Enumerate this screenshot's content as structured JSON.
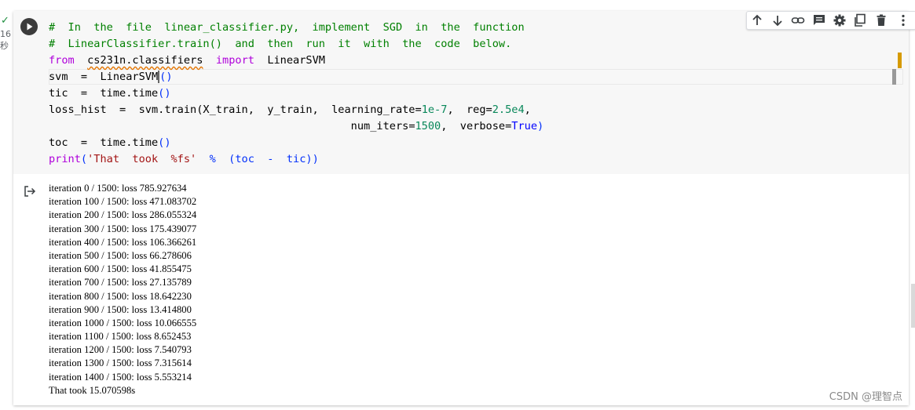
{
  "cell": {
    "status": "✓",
    "exec_time": "16\n秒",
    "code_lines": [
      "# In the file linear_classifier.py, implement SGD in the function",
      "# LinearClassifier.train() and then run it with the code below.",
      "from cs231n.classifiers import LinearSVM",
      "svm = LinearSVM()",
      "tic = time.time()",
      "loss_hist = svm.train(X_train, y_train, learning_rate=1e-7, reg=2.5e4,",
      "                      num_iters=1500, verbose=True)",
      "toc = time.time()",
      "print('That took %fs' % (toc - tic))"
    ],
    "code_tokens": {
      "comment1": "#  In  the  file  linear_classifier.py,  implement  SGD  in  the  function",
      "comment2": "#  LinearClassifier.train()  and  then  run  it  with  the  code  below.",
      "from": "from",
      "module": "cs231n.classifiers",
      "import": "import",
      "class_name": "LinearSVM",
      "svm_assign": "svm  =  LinearSVM",
      "svm_parens": "()",
      "tic_assign": "tic  =  time.time",
      "tic_parens": "()",
      "loss_prefix": "loss_hist  =  svm.train(X_train,  y_train,  learning_rate=",
      "lr_value": "1e-7",
      "reg_prefix": ",  reg=",
      "reg_value": "2.5e4",
      "reg_suffix": ",",
      "indent": "                                               ",
      "iters_prefix": "num_iters=",
      "iters_value": "1500",
      "verbose_prefix": ",  verbose=",
      "verbose_value": "True",
      "call_close": ")",
      "toc_assign": "toc  =  time.time",
      "toc_parens": "()",
      "print_kw": "print",
      "print_open": "(",
      "print_str": "'That  took  %fs'",
      "print_rest": "  %  (toc  -  tic))"
    }
  },
  "toolbar": {
    "icons": [
      "arrow-up-icon",
      "arrow-down-icon",
      "link-icon",
      "comment-icon",
      "gear-icon",
      "mirror-cell-icon",
      "delete-icon",
      "more-vert-icon"
    ]
  },
  "output": {
    "lines": [
      "iteration 0 / 1500: loss 785.927634",
      "iteration 100 / 1500: loss 471.083702",
      "iteration 200 / 1500: loss 286.055324",
      "iteration 300 / 1500: loss 175.439077",
      "iteration 400 / 1500: loss 106.366261",
      "iteration 500 / 1500: loss 66.278606",
      "iteration 600 / 1500: loss 41.855475",
      "iteration 700 / 1500: loss 27.135789",
      "iteration 800 / 1500: loss 18.642230",
      "iteration 900 / 1500: loss 13.414800",
      "iteration 1000 / 1500: loss 10.066555",
      "iteration 1100 / 1500: loss 8.652453",
      "iteration 1200 / 1500: loss 7.540793",
      "iteration 1300 / 1500: loss 7.315614",
      "iteration 1400 / 1500: loss 5.553214",
      "That took 15.070598s"
    ]
  },
  "watermark": "CSDN @理智点",
  "colors": {
    "comment": "#008000",
    "keyword": "#af00db",
    "number": "#09885a",
    "string": "#a31515",
    "run_button": "#3c3c3c",
    "status_check": "#1e8e3e"
  }
}
